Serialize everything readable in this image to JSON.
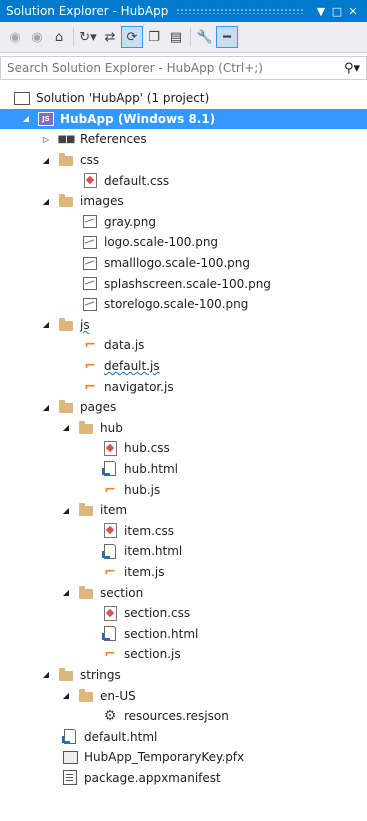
{
  "window": {
    "title": "Solution Explorer - HubApp",
    "pin_glyph": "▼",
    "maximize_glyph": "□",
    "close_glyph": "✕"
  },
  "search": {
    "placeholder": "Search Solution Explorer - HubApp (Ctrl+;)",
    "icon": "search-icon"
  },
  "toolbar": {
    "buttons": [
      "back-icon",
      "forward-icon",
      "home-icon",
      "history-icon",
      "sync-icon",
      "refresh-icon",
      "collapse-icon",
      "show-all-icon",
      "properties-icon",
      "preview-icon"
    ]
  },
  "tree": {
    "solution": "Solution 'HubApp' (1 project)",
    "project": "HubApp (Windows 8.1)",
    "references": "References",
    "css": "css",
    "default_css": "default.css",
    "images": "images",
    "gray_png": "gray.png",
    "logo_png": "logo.scale-100.png",
    "smalllogo_png": "smalllogo.scale-100.png",
    "splashscreen_png": "splashscreen.scale-100.png",
    "storelogo_png": "storelogo.scale-100.png",
    "js": "js",
    "data_js": "data.js",
    "default_js": "default.js",
    "navigator_js": "navigator.js",
    "pages": "pages",
    "hub": "hub",
    "hub_css": "hub.css",
    "hub_html": "hub.html",
    "hub_js": "hub.js",
    "item": "item",
    "item_css": "item.css",
    "item_html": "item.html",
    "item_js": "item.js",
    "section": "section",
    "section_css": "section.css",
    "section_html": "section.html",
    "section_js": "section.js",
    "strings": "strings",
    "en_us": "en-US",
    "resources": "resources.resjson",
    "default_html": "default.html",
    "pfx": "HubApp_TemporaryKey.pfx",
    "manifest": "package.appxmanifest"
  },
  "colors": {
    "title_bg": "#007acc",
    "selection": "#3399ff",
    "folder": "#dcb67a",
    "js": "#f58220"
  }
}
